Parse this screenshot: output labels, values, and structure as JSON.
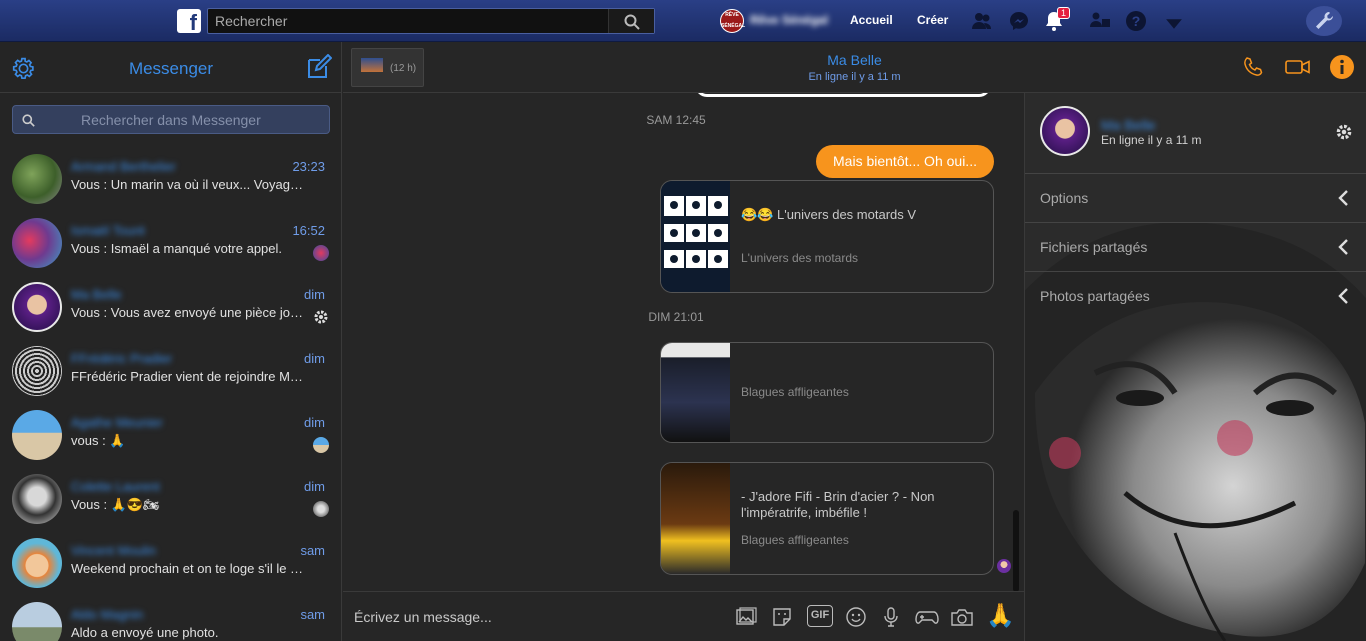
{
  "topbar": {
    "logo_letter": "f",
    "search_placeholder": "Rechercher",
    "profile_badge": "RÊVE SÉNÉGAL",
    "profile_name": "Rêve Sénégal",
    "accueil": "Accueil",
    "creer": "Créer",
    "notification_count": "1"
  },
  "left": {
    "title": "Messenger",
    "search_placeholder": "Rechercher dans Messenger",
    "conversations": [
      {
        "name": "Armand Berthelier",
        "time": "23:23",
        "preview": "Vous : Un marin va où il veux... Voyag…"
      },
      {
        "name": "Ismaël Touré",
        "time": "16:52",
        "preview": "Vous : Ismaël a manqué votre appel."
      },
      {
        "name": "Ma Belle",
        "time": "dim",
        "preview": "Vous : Vous avez envoyé une pièce jo…"
      },
      {
        "name": "FFrédéric Pradier",
        "time": "dim",
        "preview": "FFrédéric Pradier vient de rejoindre M…"
      },
      {
        "name": "Agathe Meunier",
        "time": "dim",
        "preview": "vous : 🙏"
      },
      {
        "name": "Colette Laurent",
        "time": "dim",
        "preview": "Vous : 🙏😎🏍"
      },
      {
        "name": "Vincent Moulin",
        "time": "sam",
        "preview": "Weekend prochain et on te loge s'il le …"
      },
      {
        "name": "Aldo Magnin",
        "time": "sam",
        "preview": "Aldo a envoyé une photo."
      }
    ]
  },
  "chat": {
    "tab_label": "(12 h)",
    "contact_name": "Ma Belle",
    "contact_status": "En ligne il y a 11 m",
    "stamp1": "SAM 12:45",
    "outgoing": "Mais bientôt... Oh oui...",
    "card1_title": "😂😂 L'univers des motards V",
    "card1_source": "L'univers des motards",
    "stamp2": "DIM 21:01",
    "card2_source": "Blagues affligeantes",
    "card3_title": "- J'adore Fifi - Brin d'acier ? - Non l'impératrife, imbéfile !",
    "card3_source": "Blagues affligeantes",
    "composer_placeholder": "Écrivez un message...",
    "gif_label": "GIF",
    "thumbs_emoji": "🙏"
  },
  "right": {
    "name": "Ma Belle",
    "status": "En ligne il y a 11 m",
    "rows": [
      "Options",
      "Fichiers partagés",
      "Photos partagées"
    ]
  },
  "colors": {
    "accent_blue": "#3b8ce6",
    "orange": "#f7941d",
    "topbar": "#22397a"
  }
}
